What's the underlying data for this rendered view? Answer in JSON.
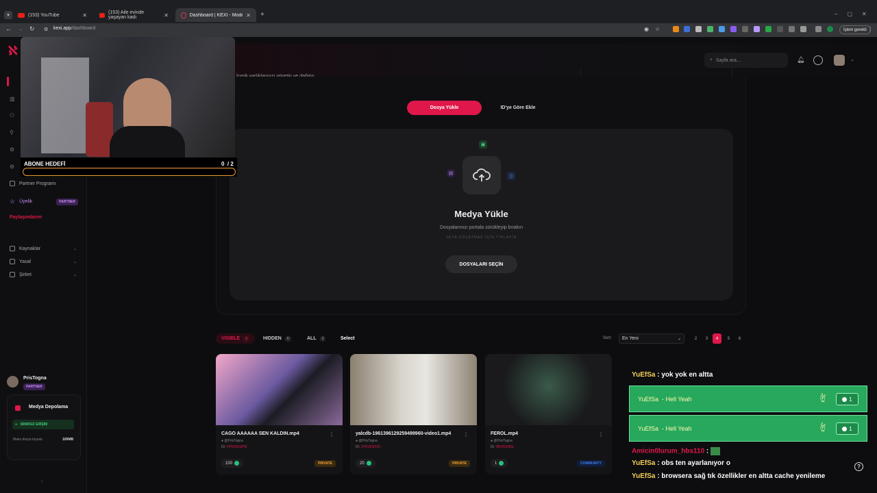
{
  "browser": {
    "tabs": [
      {
        "label": "(153) YouTube"
      },
      {
        "label": "(153) Aile evinde yaşayan kadı"
      },
      {
        "label": "Dashboard | KEXI - Modern Str"
      }
    ],
    "url_host": "kexi.app",
    "url_path": "/dashboard",
    "action_label": "İşlem gerekli"
  },
  "sidebar": {
    "items": [
      {
        "label": "Partner Programı"
      },
      {
        "label": "Üyelik",
        "badge": "PARTNER"
      },
      {
        "label": "Paylaşımlarım"
      }
    ],
    "groups": [
      {
        "label": "Kaynaklar"
      },
      {
        "label": "Yasal"
      },
      {
        "label": "Şirket"
      }
    ],
    "user": {
      "name": "PrisTogna",
      "badge": "PARTNER"
    },
    "storage": {
      "title": "Medya Depolama",
      "plan": "SINIRSIZ ERİŞİM",
      "max_label": "Maks dosya boyutu",
      "max_value": "100MB"
    }
  },
  "header": {
    "subtitle": "İçerik varlıklarınızı yönetin ve dağıtın",
    "search_placeholder": "Sayfa ara..."
  },
  "upload": {
    "tabs": {
      "upload": "Dosya Yükle",
      "by_id": "ID'ye Göre Ekle"
    },
    "title": "Medya Yükle",
    "subtitle": "Dosyalarınızı portala sürükleyip bırakın",
    "or_text": "VEYA GÖZATMAK İÇİN TIKLAYIN",
    "button": "DOSYALARI SEÇİN"
  },
  "library": {
    "filters": [
      {
        "label": "VISIBLE",
        "count": "3"
      },
      {
        "label": "HIDDEN",
        "count": "0"
      },
      {
        "label": "ALL",
        "count": "3"
      }
    ],
    "select_label": "Select",
    "sort_label": "Sort:",
    "sort_value": "En Yeni",
    "pages": [
      "2",
      "3",
      "4",
      "5",
      "6"
    ],
    "current_page": "4",
    "cards": [
      {
        "title": "CAGO AAAAAA SEN KALDIN.mp4",
        "author": "● @PrisTogna",
        "id_label": "ID:",
        "id": "FFNXNUZPE",
        "count": "100",
        "badge": "PRIVATE",
        "badge_color": "#f2a33a"
      },
      {
        "title": "yalcdb-1961396129259499960-video1.mp4",
        "author": "● @PrisTogna",
        "id_label": "ID:",
        "id": "OYF3D9X0C",
        "count": "20",
        "badge": "PRIVATE",
        "badge_color": "#f2a33a"
      },
      {
        "title": "FEROL.mp4",
        "author": "● @PrisTogna",
        "id_label": "ID:",
        "id": "9BVRUNNL",
        "count": "1",
        "badge": "COMMUNITY",
        "badge_color": "#3d7ef0"
      }
    ]
  },
  "stream": {
    "goal_label": "ABONE HEDEFİ",
    "goal_value": "0  / 2",
    "goal_progress": 0
  },
  "chat": {
    "first": {
      "user": "YuEfSa",
      "text": " : yok yok en altta"
    },
    "highlights": [
      {
        "user": "YuEfSa",
        "text": "  - Hell Yeah",
        "votes": "1"
      },
      {
        "user": "YuEfSa",
        "text": "  - Hell Yeah",
        "votes": "1"
      }
    ],
    "lines": [
      {
        "user": "Amicin0lurum_hbs110",
        "text": " : ",
        "user_color": "#e0174a"
      },
      {
        "user": "YuEfSa",
        "text": " : obs ten ayarlanıyor o",
        "user_color": "#f4d05a"
      },
      {
        "user": "YuEfSa",
        "text": " : browsera sağ tık özellikler en altta cache yenileme",
        "user_color": "#f4d05a"
      }
    ]
  }
}
